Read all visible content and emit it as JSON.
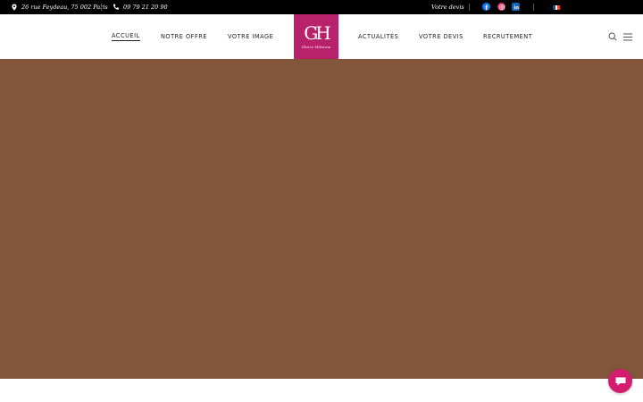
{
  "topbar": {
    "address": "26 rue Feydeau, 75 002 Paris",
    "phone": "09 79 21 20 90",
    "devis_link": "Votre devis",
    "social": [
      "facebook-icon",
      "instagram-icon",
      "linkedin-icon"
    ],
    "language_flag": "france-flag-icon"
  },
  "nav": {
    "items": [
      {
        "label": "ACCUEIL"
      },
      {
        "label": "NOTRE OFFRE"
      },
      {
        "label": "VOTRE IMAGE"
      },
      {
        "label": "ACTUALITÉS"
      },
      {
        "label": "VOTRE DEVIS"
      },
      {
        "label": "RECRUTEMENT"
      }
    ],
    "active_index": 0
  },
  "logo": {
    "monogram": "GH",
    "name": "Gloire Hôtesse"
  },
  "colors": {
    "topbar": "#000000",
    "logo_bg": "#b8226a",
    "hero_bg": "#83563c",
    "chat_bg": "#d61c6e",
    "facebook": "#1877f2",
    "instagram": "#e1306c",
    "linkedin": "#0a66c2"
  },
  "icons": {
    "search": "search-icon",
    "menu": "hamburger-menu-icon",
    "chat": "chat-bubble-icon"
  }
}
